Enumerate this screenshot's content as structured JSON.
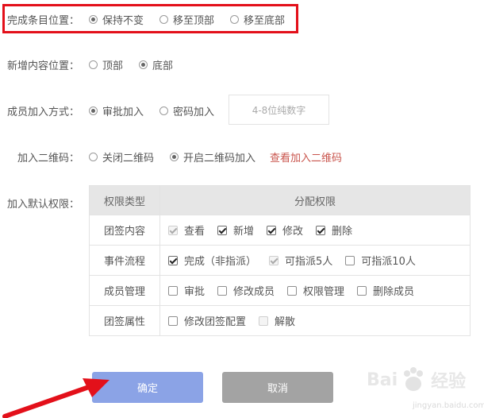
{
  "completion_position": {
    "label": "完成条目位置：",
    "options": [
      {
        "label": "保持不变",
        "selected": true
      },
      {
        "label": "移至顶部",
        "selected": false
      },
      {
        "label": "移至底部",
        "selected": false
      }
    ]
  },
  "new_content_position": {
    "label": "新增内容位置：",
    "options": [
      {
        "label": "顶部",
        "selected": false
      },
      {
        "label": "底部",
        "selected": true
      }
    ]
  },
  "join_method": {
    "label": "成员加入方式：",
    "options": [
      {
        "label": "审批加入",
        "selected": true
      },
      {
        "label": "密码加入",
        "selected": false
      }
    ],
    "password_placeholder": "4-8位纯数字"
  },
  "qr_code": {
    "label": "加入二维码：",
    "options": [
      {
        "label": "关闭二维码",
        "selected": false
      },
      {
        "label": "开启二维码加入",
        "selected": true
      }
    ],
    "view_link": "查看加入二维码"
  },
  "default_permissions": {
    "label": "加入默认权限：",
    "header_type": "权限类型",
    "header_assign": "分配权限",
    "rows": [
      {
        "type": "团签内容",
        "perms": [
          {
            "label": "查看",
            "checked": true,
            "disabled": true
          },
          {
            "label": "新增",
            "checked": true,
            "disabled": false
          },
          {
            "label": "修改",
            "checked": true,
            "disabled": false
          },
          {
            "label": "删除",
            "checked": true,
            "disabled": false
          }
        ]
      },
      {
        "type": "事件流程",
        "perms": [
          {
            "label": "完成（非指派）",
            "checked": true,
            "disabled": false
          },
          {
            "label": "可指派5人",
            "checked": true,
            "disabled": true
          },
          {
            "label": "可指派10人",
            "checked": false,
            "disabled": false
          }
        ]
      },
      {
        "type": "成员管理",
        "perms": [
          {
            "label": "审批",
            "checked": false,
            "disabled": false
          },
          {
            "label": "修改成员",
            "checked": false,
            "disabled": false
          },
          {
            "label": "权限管理",
            "checked": false,
            "disabled": false
          },
          {
            "label": "删除成员",
            "checked": false,
            "disabled": false
          }
        ]
      },
      {
        "type": "团签属性",
        "perms": [
          {
            "label": "修改团签配置",
            "checked": false,
            "disabled": false
          },
          {
            "label": "解散",
            "checked": false,
            "disabled": true
          }
        ]
      }
    ]
  },
  "buttons": {
    "confirm": "确定",
    "cancel": "取消"
  },
  "watermark": {
    "brand": "Bai",
    "brand2": "经验",
    "url": "jingyan.baidu.com"
  },
  "colors": {
    "highlight": "#e3101a",
    "confirm": "#8ba3e6",
    "cancel": "#a3a3a3",
    "link": "#c9544c"
  }
}
